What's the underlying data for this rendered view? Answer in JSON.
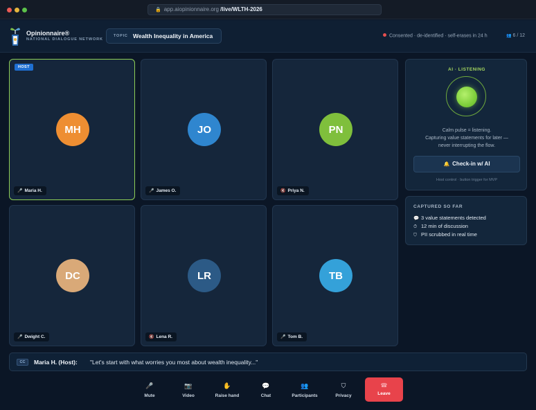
{
  "browser": {
    "host": "app.aiopinionnaire.org",
    "path": "/live/WLTH-2026"
  },
  "brand": {
    "name": "Opinionnaire®",
    "subtitle": "NATIONAL DIALOGUE NETWORK"
  },
  "topic": {
    "label": "TOPIC",
    "value": "Wealth Inequality in America"
  },
  "status": {
    "consent_text": "Consented · de-identified · self-erases in 24 h",
    "participant_count": "6 / 12"
  },
  "host_badge": "HOST",
  "participants": [
    {
      "initials": "MH",
      "name": "Maria H.",
      "mic": "mic-on",
      "color": "#ee8e32"
    },
    {
      "initials": "JO",
      "name": "James O.",
      "mic": "mic-on",
      "color": "#2f86cf"
    },
    {
      "initials": "PN",
      "name": "Priya N.",
      "mic": "mic-off",
      "color": "#7fbf3c"
    },
    {
      "initials": "DC",
      "name": "Dwight C.",
      "mic": "mic-on",
      "color": "#d9a978"
    },
    {
      "initials": "LR",
      "name": "Lena R.",
      "mic": "mic-off",
      "color": "#2c5a86"
    },
    {
      "initials": "TB",
      "name": "Tom B.",
      "mic": "mic-on",
      "color": "#34a1d9"
    }
  ],
  "ai_panel": {
    "title": "AI · LISTENING",
    "desc_line1": "Calm pulse = listening.",
    "desc_line2": "Capturing value statements for later —",
    "desc_line3": "never interrupting the flow.",
    "checkin_label": "Check-in w/ AI",
    "note": "Host control · button trigger for MVP"
  },
  "captured": {
    "title": "CAPTURED SO FAR",
    "items": [
      {
        "icon": "speech-bubble-icon",
        "text": "3 value statements detected"
      },
      {
        "icon": "clock-icon",
        "text": "12 min of discussion"
      },
      {
        "icon": "shield-icon",
        "text": "PII scrubbed in real time"
      }
    ]
  },
  "caption": {
    "badge": "CC",
    "speaker": "Maria H. (Host):",
    "text": "\"Let's start with what worries you most about wealth inequality...\""
  },
  "controls": [
    {
      "icon": "microphone-icon",
      "label": "Mute"
    },
    {
      "icon": "video-camera-icon",
      "label": "Video"
    },
    {
      "icon": "raised-hand-icon",
      "label": "Raise hand"
    },
    {
      "icon": "chat-bubble-icon",
      "label": "Chat"
    },
    {
      "icon": "participants-icon",
      "label": "Participants"
    },
    {
      "icon": "shield-icon",
      "label": "Privacy"
    },
    {
      "icon": "phone-hangup-icon",
      "label": "Leave"
    }
  ],
  "colors": {
    "background": "#0b1626",
    "accent_green": "#a6d85f",
    "host_border": "#8fcf56",
    "leave_red": "#e8434b",
    "host_badge_blue": "#1f6fd1"
  }
}
